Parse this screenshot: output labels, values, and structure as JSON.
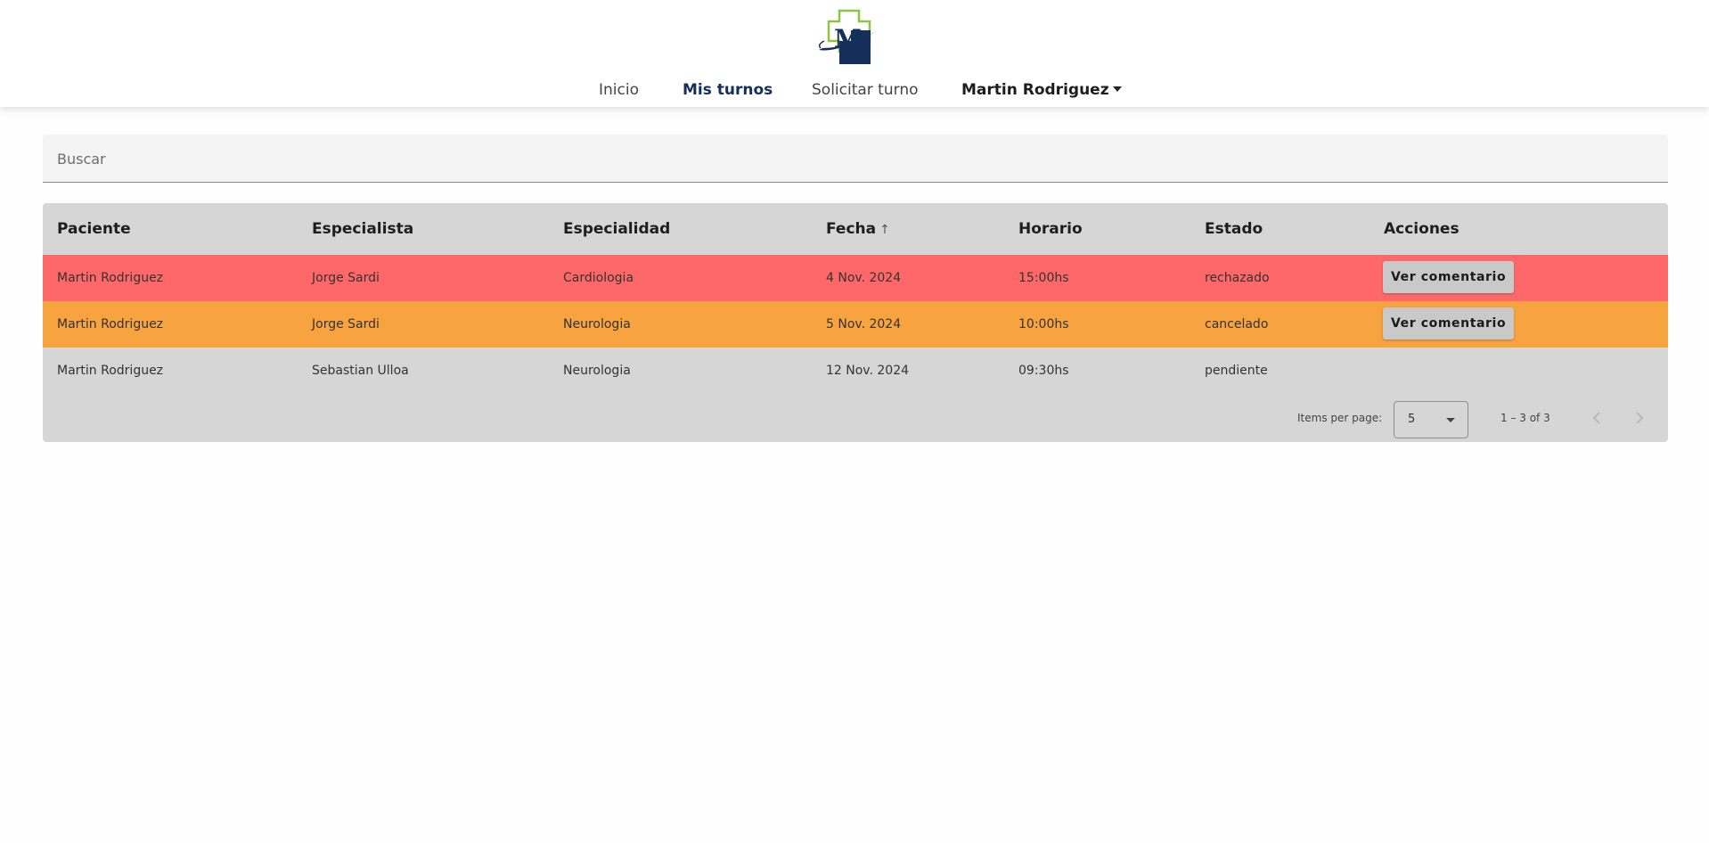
{
  "nav": {
    "inicio": "Inicio",
    "mis_turnos": "Mis turnos",
    "solicitar_turno": "Solicitar turno",
    "user": "Martin Rodriguez"
  },
  "search": {
    "placeholder": "Buscar",
    "value": ""
  },
  "table": {
    "headers": [
      "Paciente",
      "Especialista",
      "Especialidad",
      "Fecha",
      "Horario",
      "Estado",
      "Acciones"
    ],
    "sorted_column": "Fecha",
    "sort_icon": "arrow-up-icon",
    "rows": [
      {
        "paciente": "Martin Rodriguez",
        "especialista": "Jorge Sardi",
        "especialidad": "Cardiologia",
        "fecha": "4 Nov. 2024",
        "horario": "15:00hs",
        "estado": "rechazado",
        "accion": "Ver comentario",
        "color": "#ff6868"
      },
      {
        "paciente": "Martin Rodriguez",
        "especialista": "Jorge Sardi",
        "especialidad": "Neurologia",
        "fecha": "5 Nov. 2024",
        "horario": "10:00hs",
        "estado": "cancelado",
        "accion": "Ver comentario",
        "color": "#f7a33f"
      },
      {
        "paciente": "Martin Rodriguez",
        "especialista": "Sebastian Ulloa",
        "especialidad": "Neurologia",
        "fecha": "12 Nov. 2024",
        "horario": "09:30hs",
        "estado": "pendiente",
        "accion": "",
        "color": "#d6d6d6"
      }
    ]
  },
  "paginator": {
    "items_per_page_label": "Items per page:",
    "page_size": "5",
    "range": "1 – 3 of 3"
  },
  "colors": {
    "brand_navy": "#14305a",
    "brand_green": "#8cc63f"
  }
}
